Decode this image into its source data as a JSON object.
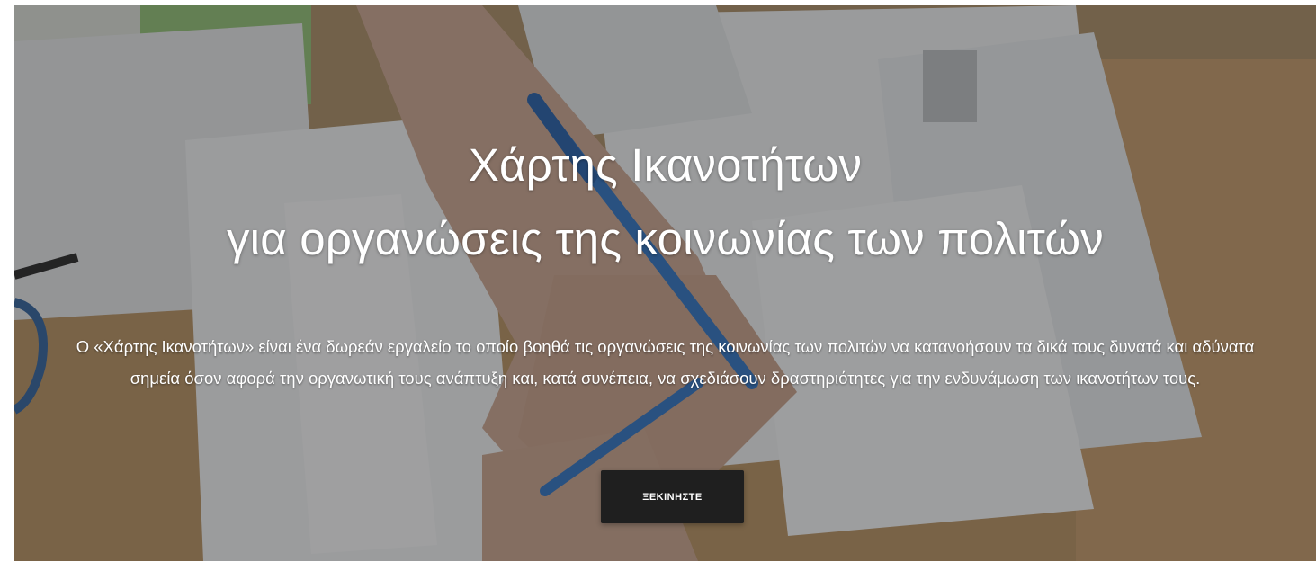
{
  "hero": {
    "title_line1": "Χάρτης Ικανοτήτων",
    "title_line2": "για οργανώσεις της κοινωνίας των πολιτών",
    "description": "Ο «Χάρτης Ικανοτήτων» είναι ένα δωρεάν εργαλείο το οποίο βοηθά τις οργανώσεις της κοινωνίας των πολιτών να κατανοήσουν τα δικά τους δυνατά και αδύνατα σημεία όσον αφορά την οργανωτική τους ανάπτυξη και, κατά συνέπεια, να σχεδιάσουν δραστηριότητες για την ενδυνάμωση των ικανοτήτων τους.",
    "start_button_label": "ΞΕΚΙΝΗΣΤΕ",
    "background_image": "photo-hands-writing-on-documents-icon",
    "colors": {
      "overlay": "#282828",
      "button_bg": "#1f1f1f",
      "text": "#ffffff",
      "pen_blue": "#2a6fc0",
      "wood": "#b08a5a"
    }
  }
}
